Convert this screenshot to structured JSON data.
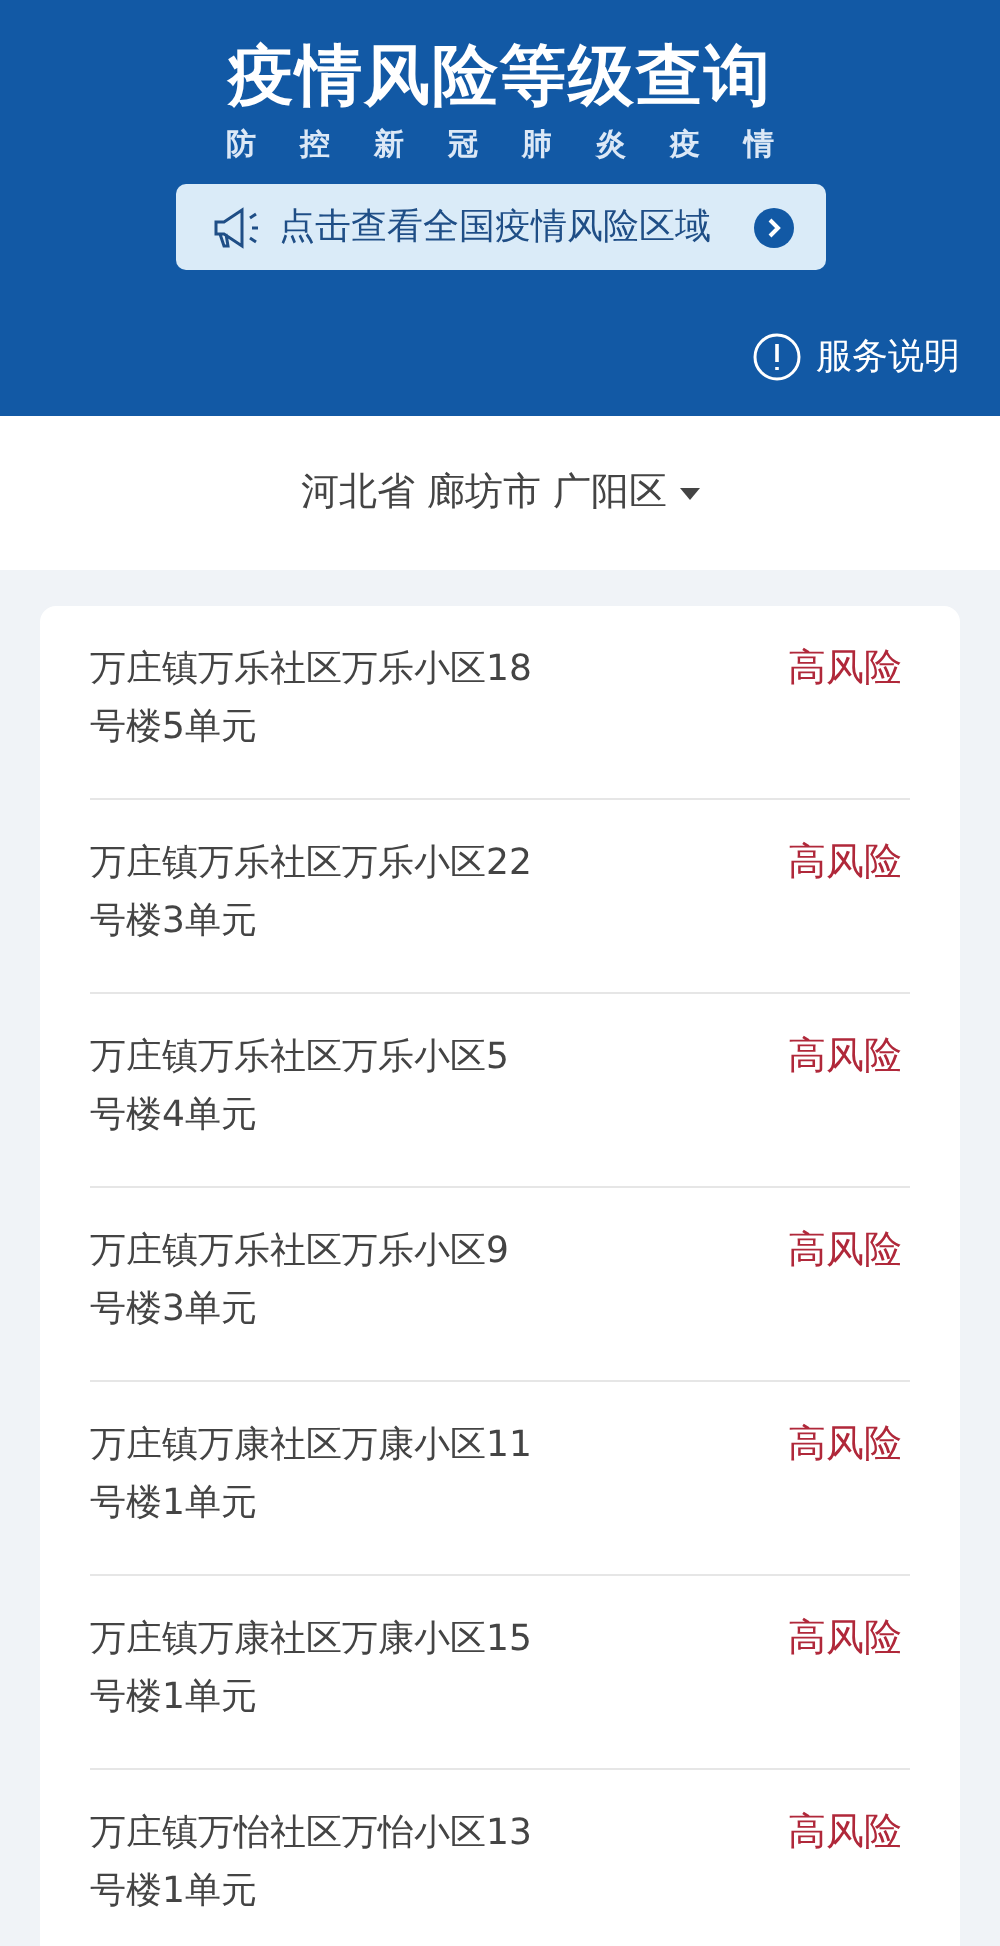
{
  "header": {
    "title": "疫情风险等级查询",
    "subtitle": "防控新冠肺炎疫情",
    "banner": "点击查看全国疫情风险区域",
    "service_link": "服务说明"
  },
  "region": {
    "label": "河北省 廊坊市 广阳区"
  },
  "areas": [
    {
      "address_lines": [
        "万庄镇万乐社区万乐小区18",
        "号楼5单元"
      ],
      "risk": "高风险",
      "kind": "high"
    },
    {
      "address_lines": [
        "万庄镇万乐社区万乐小区22",
        "号楼3单元"
      ],
      "risk": "高风险",
      "kind": "high"
    },
    {
      "address_lines": [
        "万庄镇万乐社区万乐小区5",
        "号楼4单元"
      ],
      "risk": "高风险",
      "kind": "high"
    },
    {
      "address_lines": [
        "万庄镇万乐社区万乐小区9",
        "号楼3单元"
      ],
      "risk": "高风险",
      "kind": "high"
    },
    {
      "address_lines": [
        "万庄镇万康社区万康小区11",
        "号楼1单元"
      ],
      "risk": "高风险",
      "kind": "high"
    },
    {
      "address_lines": [
        "万庄镇万康社区万康小区15",
        "号楼1单元"
      ],
      "risk": "高风险",
      "kind": "high"
    },
    {
      "address_lines": [
        "万庄镇万怡社区万怡小区13",
        "号楼1单元"
      ],
      "risk": "高风险",
      "kind": "high"
    }
  ]
}
